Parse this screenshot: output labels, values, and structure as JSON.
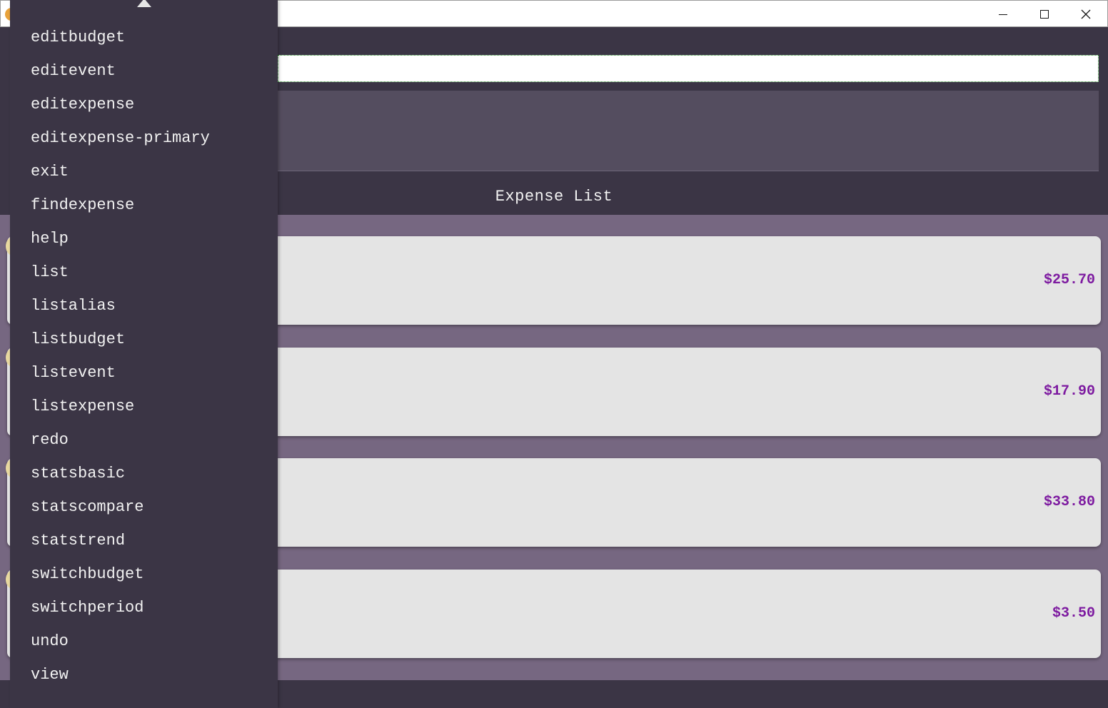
{
  "window": {
    "minimize_icon": "minimize-icon",
    "maximize_icon": "maximize-icon",
    "close_icon": "close-icon"
  },
  "expense_list": {
    "title": "Expense List",
    "items": [
      {
        "amount": "$25.70"
      },
      {
        "amount": "$17.90"
      },
      {
        "amount": "$33.80"
      },
      {
        "amount": "$3.50"
      }
    ]
  },
  "autocomplete": {
    "items": [
      "editbudget",
      "editevent",
      "editexpense",
      "editexpense-primary",
      "exit",
      "findexpense",
      "help",
      "list",
      "listalias",
      "listbudget",
      "listevent",
      "listexpense",
      "redo",
      "statsbasic",
      "statscompare",
      "statstrend",
      "switchbudget",
      "switchperiod",
      "undo",
      "view"
    ]
  },
  "colors": {
    "background": "#3b3545",
    "list_panel": "#766781",
    "card": "#e4e4e4",
    "amount": "#7d1aa0"
  }
}
